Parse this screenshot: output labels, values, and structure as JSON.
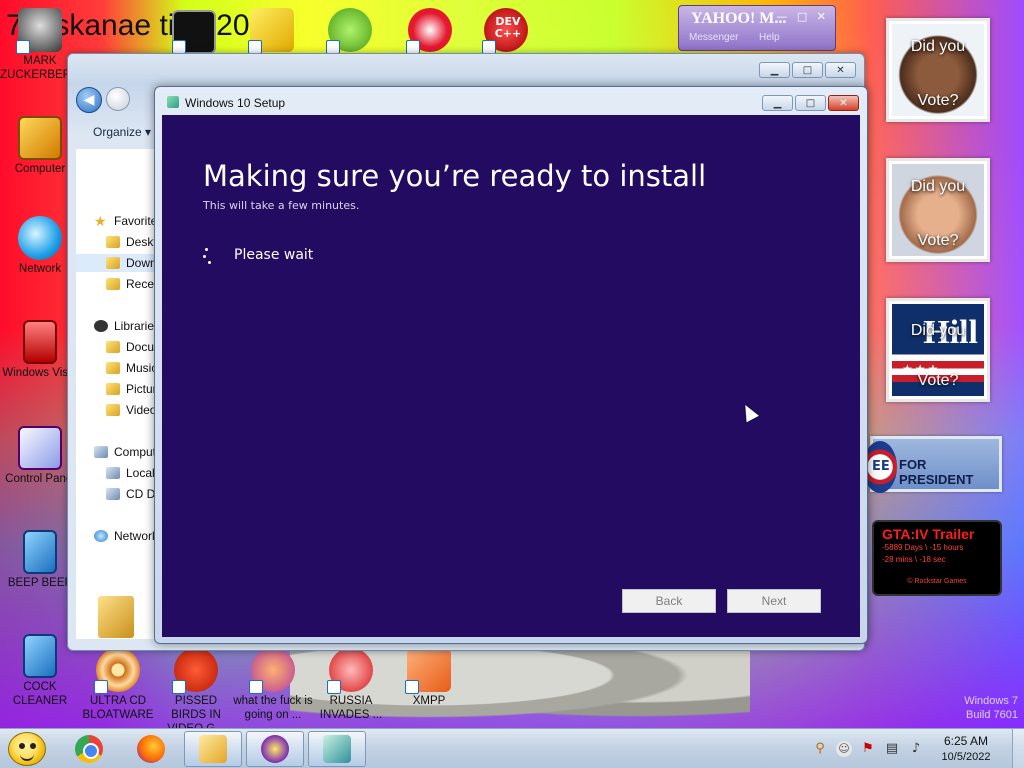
{
  "desktop": {
    "title_text": "7osskanae tion 2012",
    "icons_left": [
      {
        "label": "MARK ZUCKERBERG",
        "icon": "mark-zuckerberg-icon"
      },
      {
        "label": "Computer",
        "icon": "computer-icon"
      },
      {
        "label": "Network",
        "icon": "network-icon"
      },
      {
        "label": "Windows Vista",
        "icon": "recycle-bin-icon"
      },
      {
        "label": "Control Panel",
        "icon": "control-panel-icon"
      },
      {
        "label": "BEEP BEEP",
        "icon": "beep-beep-icon"
      },
      {
        "label": "COCK CLEANER",
        "icon": "cock-cleaner-icon"
      }
    ],
    "icons_bottom": [
      {
        "label": "ULTRA CD BLOATWARE",
        "icon": "cd-icon"
      },
      {
        "label": "PISSED BIRDS IN VIDEO G...",
        "icon": "bird-icon"
      },
      {
        "label": "what the fuck is going on ...",
        "icon": "pike-icon"
      },
      {
        "label": "RUSSIA INVADES ...",
        "icon": "russia-icon"
      },
      {
        "label": "XMPP",
        "icon": "xmpp-icon"
      }
    ],
    "icons_top": [
      "command-prompt-icon",
      "folder-stack-icon",
      "pig-icon",
      "p-icon",
      "dev-cpp-icon"
    ],
    "dev_label": "DEV C++",
    "watermark_line1": "Windows 7",
    "watermark_line2": "Build 7601"
  },
  "gadgets": {
    "yahoo": {
      "logo": "YAHOO! M...",
      "sub": "Messenger",
      "help": "Help"
    },
    "photos": [
      {
        "top": "Did you",
        "bottom": "Vote?"
      },
      {
        "top": "Did you",
        "bottom": "Vote?"
      },
      {
        "top": "Did you",
        "bottom": "Vote?",
        "overlay": "Hill"
      }
    ],
    "president": {
      "badge": "EE",
      "text": "FOR PRESIDENT"
    },
    "gta": {
      "title": "GTA:IV Trailer",
      "line1": "-5889 Days \\ -15 hours",
      "line2": "-28 mins \\ -18 sec",
      "footer": "© Rockstar Games"
    }
  },
  "explorer": {
    "organize_label": "Organize",
    "nav": [
      {
        "label": "Favorites",
        "icon": "star"
      },
      {
        "label": "Desktop",
        "icon": "folder"
      },
      {
        "label": "Downloads",
        "icon": "folder",
        "selected": true
      },
      {
        "label": "Recent Places",
        "icon": "folder"
      },
      {
        "label": "Libraries",
        "icon": "lib"
      },
      {
        "label": "Documents",
        "icon": "folder"
      },
      {
        "label": "Music",
        "icon": "folder"
      },
      {
        "label": "Pictures",
        "icon": "folder"
      },
      {
        "label": "Videos",
        "icon": "folder"
      },
      {
        "label": "Computer",
        "icon": "pc"
      },
      {
        "label": "Local Disk",
        "icon": "pc"
      },
      {
        "label": "CD Drive",
        "icon": "pc"
      },
      {
        "label": "Network",
        "icon": "net"
      }
    ]
  },
  "setup": {
    "window_title": "Windows 10 Setup",
    "heading": "Making sure you’re ready to install",
    "subheading": "This will take a few minutes.",
    "status": "Please wait",
    "back_label": "Back",
    "next_label": "Next"
  },
  "taskbar": {
    "time": "6:25 AM",
    "date": "10/5/2022",
    "buttons": [
      "chrome",
      "firefox",
      "explorer",
      "yahoo-messenger",
      "windows-setup"
    ]
  }
}
